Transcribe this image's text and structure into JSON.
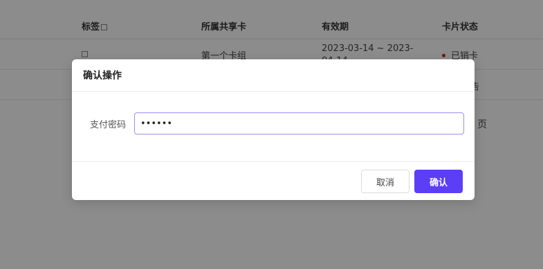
{
  "table": {
    "headers": {
      "tag": "标签",
      "card": "所属共享卡",
      "valid": "有效期",
      "status": "卡片状态"
    },
    "rows": [
      {
        "card": "第一个卡组",
        "valid": "2023-03-14 ~ 2023-04-14",
        "status": "已销卡"
      },
      {
        "status": "告"
      }
    ],
    "page_suffix": "页"
  },
  "dialog": {
    "title": "确认操作",
    "field_label": "支付密码",
    "password_value": "••••••",
    "cancel_label": "取消",
    "confirm_label": "确认"
  },
  "colors": {
    "accent": "#5b3ef6",
    "status_dot": "#e02020"
  }
}
